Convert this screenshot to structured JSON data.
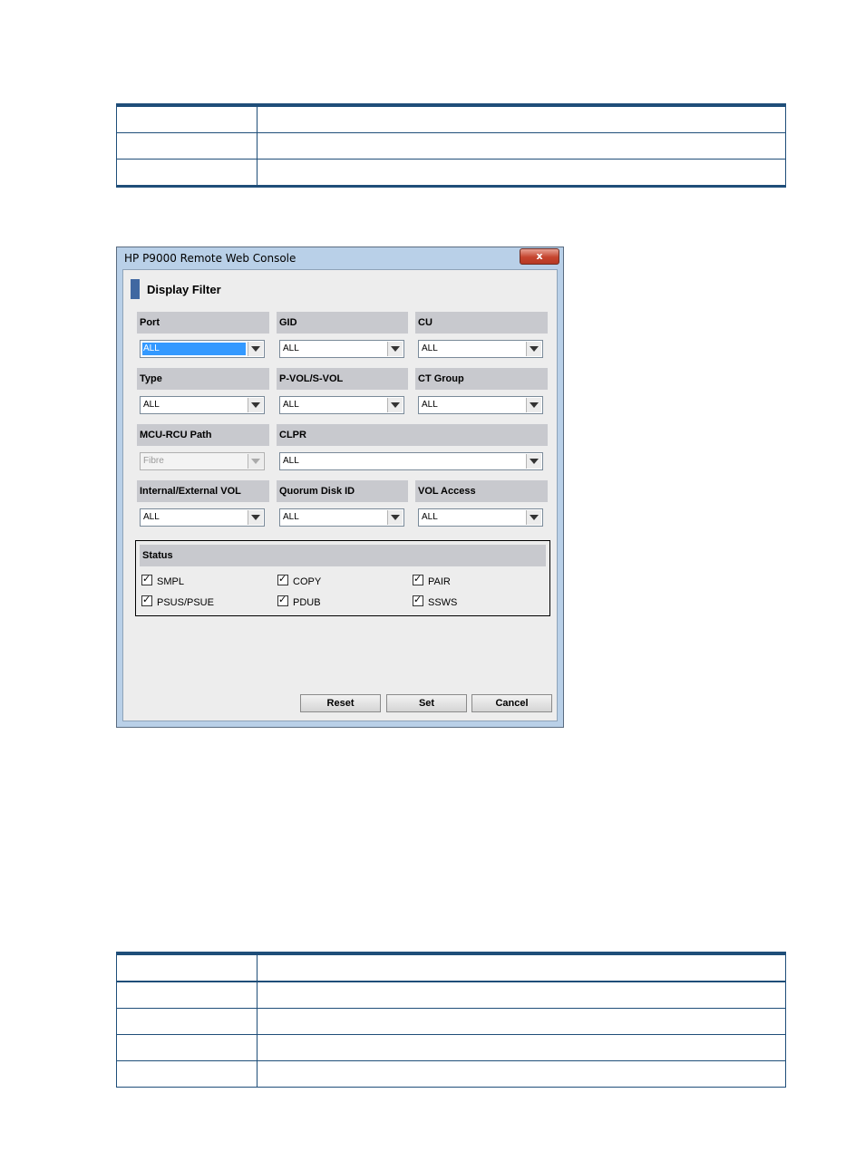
{
  "dialog": {
    "title": "HP P9000 Remote Web Console",
    "close_label": "x",
    "heading": "Display Filter",
    "filters": {
      "port": {
        "label": "Port",
        "value": "ALL"
      },
      "gid": {
        "label": "GID",
        "value": "ALL"
      },
      "cu": {
        "label": "CU",
        "value": "ALL"
      },
      "type": {
        "label": "Type",
        "value": "ALL"
      },
      "pvol_svol": {
        "label": "P-VOL/S-VOL",
        "value": "ALL"
      },
      "ct_group": {
        "label": "CT Group",
        "value": "ALL"
      },
      "mcu_rcu_path": {
        "label": "MCU-RCU Path",
        "value": "Fibre",
        "disabled": true
      },
      "clpr": {
        "label": "CLPR",
        "value": "ALL"
      },
      "internal_external_vol": {
        "label": "Internal/External VOL",
        "value": "ALL"
      },
      "quorum_disk_id": {
        "label": "Quorum Disk ID",
        "value": "ALL"
      },
      "vol_access": {
        "label": "VOL Access",
        "value": "ALL"
      }
    },
    "status": {
      "label": "Status",
      "checkboxes": [
        {
          "label": "SMPL",
          "checked": true
        },
        {
          "label": "COPY",
          "checked": true
        },
        {
          "label": "PAIR",
          "checked": true
        },
        {
          "label": "PSUS/PSUE",
          "checked": true
        },
        {
          "label": "PDUB",
          "checked": true
        },
        {
          "label": "SSWS",
          "checked": true
        }
      ]
    },
    "buttons": {
      "reset": "Reset",
      "set": "Set",
      "cancel": "Cancel"
    }
  }
}
